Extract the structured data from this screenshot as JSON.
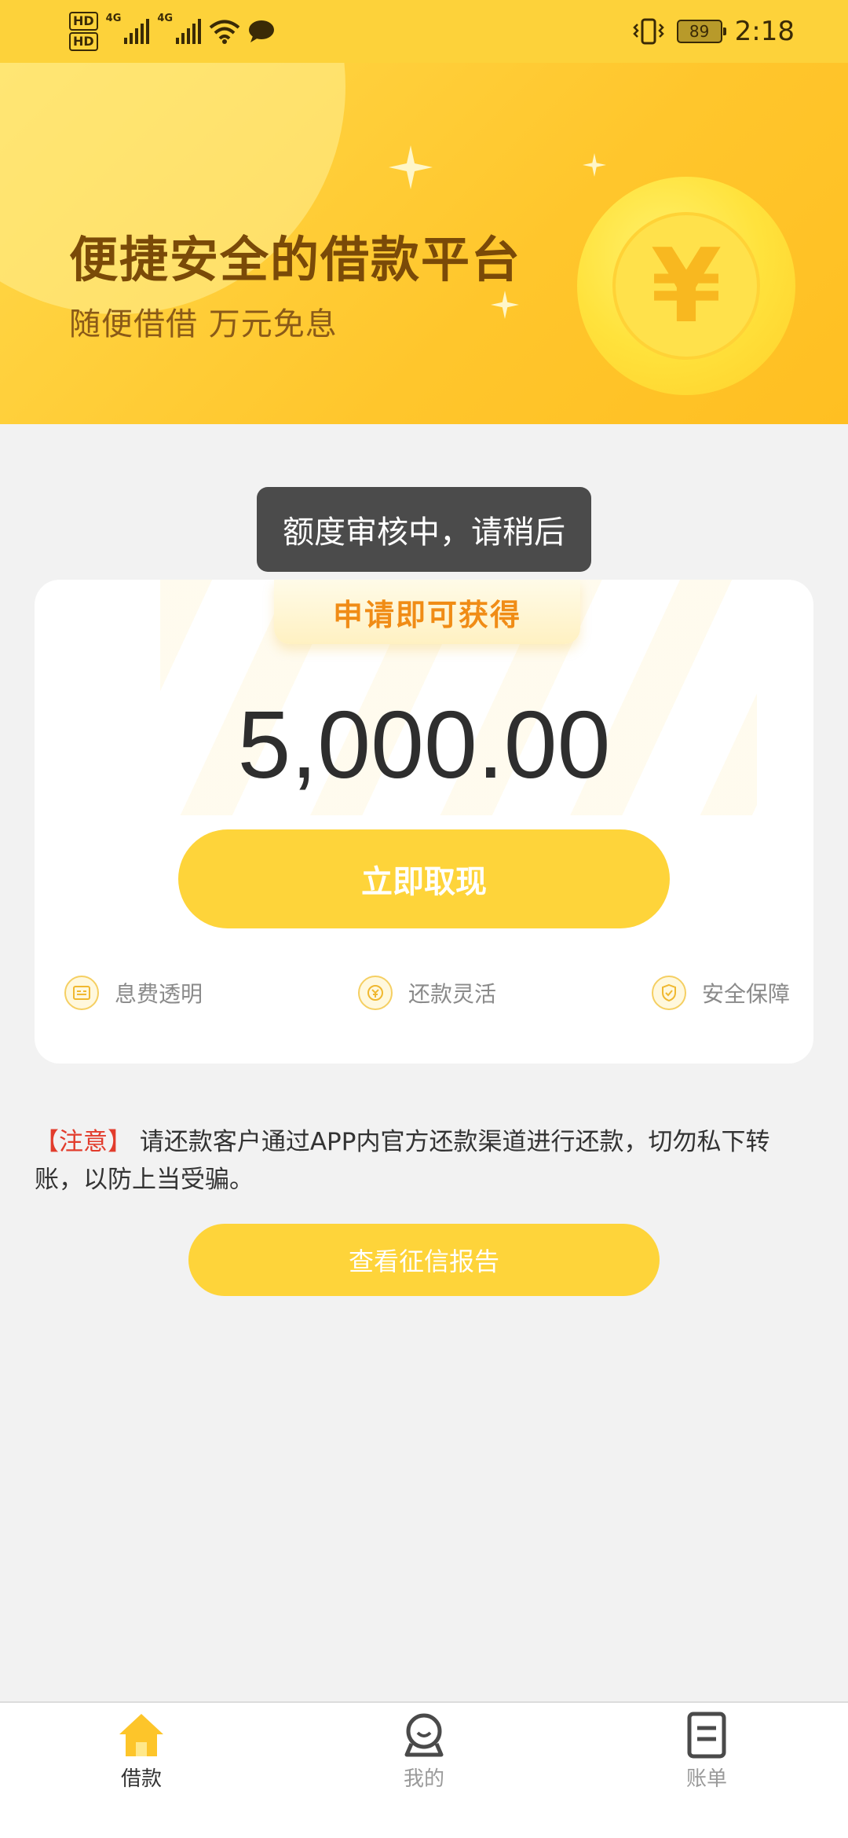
{
  "status_bar": {
    "hd1": "HD",
    "hd2": "HD",
    "net1": "4G",
    "net2": "4G",
    "battery": "89",
    "time": "2:18"
  },
  "banner": {
    "title": "便捷安全的借款平台",
    "subtitle": "随便借借 万元免息",
    "coin_symbol": "¥"
  },
  "toast": {
    "text": "额度审核中，请稍后"
  },
  "card": {
    "ribbon": "申请即可获得",
    "amount": "5,000.00",
    "withdraw_button": "立即取现",
    "features": [
      {
        "label": "息费透明",
        "icon": "fee-icon"
      },
      {
        "label": "还款灵活",
        "icon": "repay-icon"
      },
      {
        "label": "安全保障",
        "icon": "shield-icon"
      }
    ]
  },
  "notice": {
    "tag": "【注意】",
    "text": " 请还款客户通过APP内官方还款渠道进行还款，切勿私下转账，以防上当受骗。"
  },
  "report_button": "查看征信报告",
  "tabbar": {
    "active": 0,
    "items": [
      {
        "label": "借款",
        "icon": "home-icon"
      },
      {
        "label": "我的",
        "icon": "profile-icon"
      },
      {
        "label": "账单",
        "icon": "bill-icon"
      }
    ]
  },
  "colors": {
    "primary": "#fed43a",
    "banner_title": "#7a4a08",
    "ribbon_text": "#f08c16",
    "notice_tag": "#e23c2c"
  }
}
